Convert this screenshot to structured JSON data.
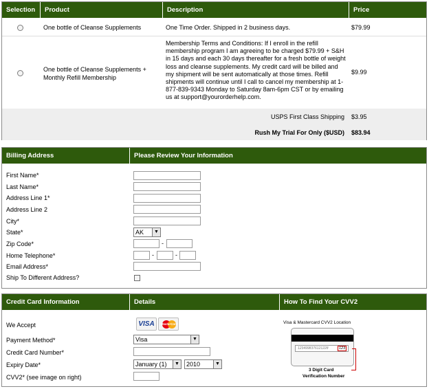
{
  "order": {
    "headers": {
      "selection": "Selection",
      "product": "Product",
      "description": "Description",
      "price": "Price"
    },
    "items": [
      {
        "product": "One bottle of Cleanse Supplements",
        "description": "One Time Order. Shipped in 2 business days.",
        "price": "$79.99",
        "selected": false
      },
      {
        "product": "One bottle of Cleanse Supplements + Monthly Refill Membership",
        "description": "Membership Terms and Conditions: If I enroll in the refill membership program I am agreeing to be charged $79.99 + S&H in 15 days and each 30 days thereafter for a fresh bottle of weight loss and cleanse supplements. My credit card will be billed and my shipment will be sent automatically at those times. Refill shipments will continue until I call to cancel my membership at 1-877-839-9343 Monday to Saturday 8am-6pm CST or by emailing us at support@yourorderhelp.com.",
        "price": "$9.99",
        "selected": false
      }
    ],
    "shipping_label": "USPS First Class Shipping",
    "shipping_price": "$3.95",
    "total_label": "Rush My Trial For Only ($USD)",
    "total_price": "$83.94"
  },
  "billing": {
    "headers": {
      "left": "Billing Address",
      "right": "Please Review Your Information"
    },
    "fields": {
      "first_name": "First Name*",
      "last_name": "Last Name*",
      "address1": "Address Line 1*",
      "address2": "Address Line 2",
      "city": "City*",
      "state": "State*",
      "zip": "Zip Code*",
      "phone": "Home Telephone*",
      "email": "Email Address*",
      "ship_different": "Ship To Different Address?"
    },
    "state_value": "AK"
  },
  "payment": {
    "headers": {
      "left": "Credit Card Information",
      "mid": "Details",
      "right": "How To Find Your CVV2"
    },
    "we_accept": "We Accept",
    "visa_logo": "VISA",
    "mc_logo": "MasterCard",
    "payment_method": "Payment Method*",
    "payment_method_value": "Visa",
    "card_number": "Credit Card Number*",
    "expiry": "Expiry Date*",
    "expiry_month": "January (1)",
    "expiry_year": "2010",
    "cvv": "CVV2* (see image on right)",
    "cvv_title": "Visa & Mastercard CVV2 Location",
    "cvv_card_digits": "1234998376121228",
    "cvv_code": "123",
    "cvv_caption_1": "3 Digit Card",
    "cvv_caption_2": "Verification Number"
  },
  "colors": {
    "header_green": "#2e5a0c",
    "row_alt": "#eeeeee"
  }
}
